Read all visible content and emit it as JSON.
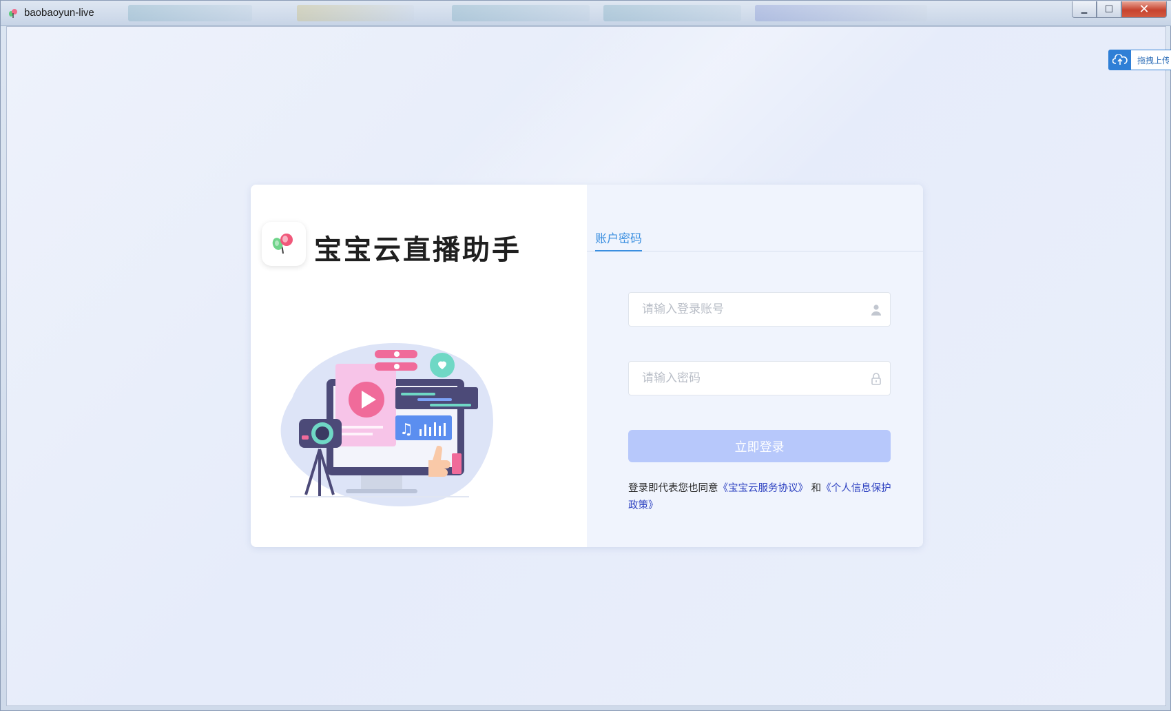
{
  "window": {
    "title": "baobaoyun-live",
    "minimize_label": "▁",
    "maximize_label": "☐",
    "close_label": "✕"
  },
  "upload": {
    "label": "拖拽上传"
  },
  "brand": {
    "name": "宝宝云直播助手"
  },
  "login": {
    "tab_label": "账户密码",
    "account_placeholder": "请输入登录账号",
    "password_placeholder": "请输入密码",
    "submit_label": "立即登录",
    "agreement_prefix": "登录即代表您也同意",
    "service_agreement": "《宝宝云服务协议》",
    "conjunction": " 和",
    "privacy_policy": "《个人信息保护政策》"
  },
  "colors": {
    "accent": "#3b8fe0",
    "button_disabled": "#b7c8fb",
    "link": "#2b3fc0"
  },
  "icons": {
    "account": "user-icon",
    "password": "lock-icon",
    "upload": "cloud-upload-icon"
  }
}
